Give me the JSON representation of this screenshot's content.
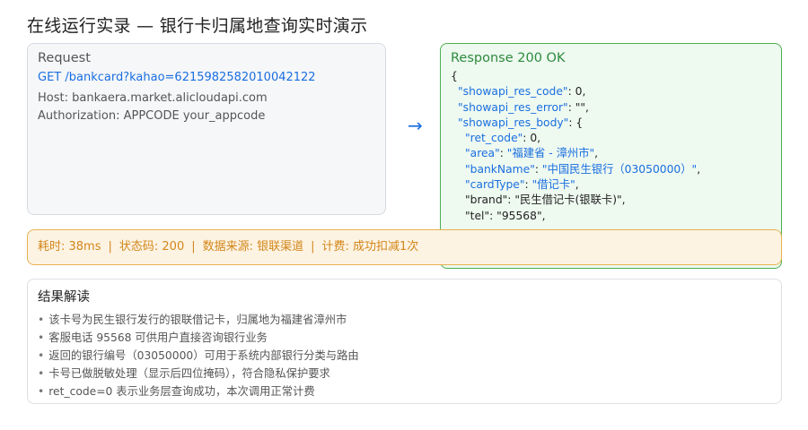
{
  "title": "在线运行实录 — 银行卡归属地查询实时演示",
  "request": {
    "label": "Request",
    "method_url": "GET /bankcard?kahao=6215982582010042122",
    "host": "Host: bankaera.market.alicloudapi.com",
    "auth": "Authorization: APPCODE your_appcode"
  },
  "arrow": "→",
  "response": {
    "label": "Response 200 OK",
    "lines": [
      {
        "indent": 0,
        "parts": [
          {
            "t": "{",
            "c": "p"
          }
        ]
      },
      {
        "indent": 1,
        "parts": [
          {
            "t": "\"showapi_res_code\"",
            "c": "k"
          },
          {
            "t": ": 0,",
            "c": "p"
          }
        ]
      },
      {
        "indent": 1,
        "parts": [
          {
            "t": "\"showapi_res_error\"",
            "c": "k"
          },
          {
            "t": ": \"\",",
            "c": "p"
          }
        ]
      },
      {
        "indent": 1,
        "parts": [
          {
            "t": "\"showapi_res_body\"",
            "c": "k"
          },
          {
            "t": ": {",
            "c": "p"
          }
        ]
      },
      {
        "indent": 2,
        "parts": [
          {
            "t": "\"ret_code\"",
            "c": "k"
          },
          {
            "t": ": 0,",
            "c": "p"
          }
        ]
      },
      {
        "indent": 2,
        "parts": [
          {
            "t": "\"area\"",
            "c": "k"
          },
          {
            "t": ": ",
            "c": "p"
          },
          {
            "t": "\"福建省 - 漳州市\"",
            "c": "s"
          },
          {
            "t": ",",
            "c": "p"
          }
        ]
      },
      {
        "indent": 2,
        "parts": [
          {
            "t": "\"bankName\"",
            "c": "k"
          },
          {
            "t": ": ",
            "c": "p"
          },
          {
            "t": "\"中国民生银行（03050000）\"",
            "c": "s"
          },
          {
            "t": ",",
            "c": "p"
          }
        ]
      },
      {
        "indent": 2,
        "parts": [
          {
            "t": "\"cardType\"",
            "c": "k"
          },
          {
            "t": ": ",
            "c": "p"
          },
          {
            "t": "\"借记卡\"",
            "c": "s"
          },
          {
            "t": ",",
            "c": "p"
          }
        ]
      },
      {
        "indent": 2,
        "parts": [
          {
            "t": "\"brand\": \"民生借记卡(银联卡)\",",
            "c": "p"
          }
        ]
      },
      {
        "indent": 2,
        "parts": [
          {
            "t": "\"tel\": \"95568\",",
            "c": "p"
          }
        ]
      }
    ]
  },
  "metrics": {
    "time": "耗时: 38ms",
    "status": "状态码: 200",
    "source": "数据来源: 银联渠道",
    "billing": "计费: 成功扣减1次",
    "separator": "|"
  },
  "result": {
    "label": "结果解读",
    "bullet": "•",
    "items": [
      "该卡号为民生银行发行的银联借记卡，归属地为福建省漳州市",
      "客服电话 95568 可供用户直接咨询银行业务",
      "返回的银行编号（03050000）可用于系统内部银行分类与路由",
      "卡号已做脱敏处理（显示后四位掩码），符合隐私保护要求",
      "ret_code=0 表示业务层查询成功，本次调用正常计费"
    ]
  }
}
